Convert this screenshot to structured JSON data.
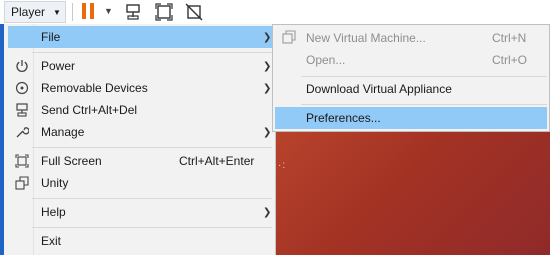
{
  "toolbar": {
    "player_label": "Player",
    "icons": [
      "pause-icon",
      "dropdown-caret-icon",
      "send-ctrl-alt-del-icon",
      "fit-window-icon",
      "unity-off-icon"
    ]
  },
  "menu": {
    "items": [
      {
        "label": "File",
        "shortcut": "",
        "has_submenu": true,
        "icon": ""
      },
      {
        "label": "Power",
        "shortcut": "",
        "has_submenu": true,
        "icon": "power-icon"
      },
      {
        "label": "Removable Devices",
        "shortcut": "",
        "has_submenu": true,
        "icon": "removable-devices-icon"
      },
      {
        "label": "Send Ctrl+Alt+Del",
        "shortcut": "",
        "has_submenu": false,
        "icon": "send-ctrl-alt-del-icon"
      },
      {
        "label": "Manage",
        "shortcut": "",
        "has_submenu": true,
        "icon": "wrench-icon"
      },
      {
        "label": "Full Screen",
        "shortcut": "Ctrl+Alt+Enter",
        "has_submenu": false,
        "icon": "full-screen-icon"
      },
      {
        "label": "Unity",
        "shortcut": "",
        "has_submenu": false,
        "icon": "unity-icon"
      },
      {
        "label": "Help",
        "shortcut": "",
        "has_submenu": true,
        "icon": ""
      },
      {
        "label": "Exit",
        "shortcut": "",
        "has_submenu": false,
        "icon": ""
      }
    ]
  },
  "submenu": {
    "items": [
      {
        "label": "New Virtual Machine...",
        "shortcut": "Ctrl+N",
        "disabled": true
      },
      {
        "label": "Open...",
        "shortcut": "Ctrl+O",
        "disabled": true
      },
      {
        "label": "Download Virtual Appliance",
        "shortcut": "",
        "disabled": false
      },
      {
        "label": "Preferences...",
        "shortcut": "",
        "disabled": false
      }
    ]
  },
  "colors": {
    "highlight": "#91c9f7",
    "accent_pause": "#ea6a0c",
    "vm_background": "#a33224"
  }
}
